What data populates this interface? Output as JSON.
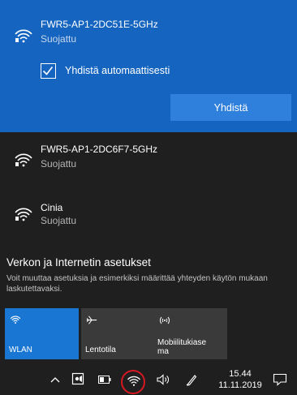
{
  "networks": [
    {
      "ssid": "FWR5-AP1-2DC51E-5GHz",
      "status": "Suojattu",
      "selected": true
    },
    {
      "ssid": "FWR5-AP1-2DC6F7-5GHz",
      "status": "Suojattu",
      "selected": false
    },
    {
      "ssid": "Cinia",
      "status": "Suojattu",
      "selected": false
    }
  ],
  "auto_connect": {
    "label": "Yhdistä automaattisesti",
    "checked": true
  },
  "connect_button": "Yhdistä",
  "settings": {
    "title": "Verkon ja Internetin asetukset",
    "description": "Voit muuttaa asetuksia ja esimerkiksi määrittää yhteyden käytön mukaan laskutettavaksi."
  },
  "quick_actions": [
    {
      "label": "WLAN",
      "icon": "wifi-icon",
      "active": true
    },
    {
      "label": "Lentotila",
      "icon": "airplane-icon",
      "active": false
    },
    {
      "label_line1": "Mobiilitukiase",
      "label_line2": "ma",
      "icon": "hotspot-icon",
      "active": false
    }
  ],
  "taskbar": {
    "time": "15.44",
    "date": "11.11.2019",
    "icons": [
      "chevron-up-icon",
      "meet-now-icon",
      "battery-icon",
      "wifi-icon",
      "volume-icon",
      "pen-icon",
      "notification-icon"
    ]
  },
  "colors": {
    "selected_bg": "#1565c0",
    "accent_button": "#2f7fdc",
    "tile_active": "#1976d2",
    "panel_bg": "#1f1f1f",
    "highlight_circle": "#d51822"
  }
}
